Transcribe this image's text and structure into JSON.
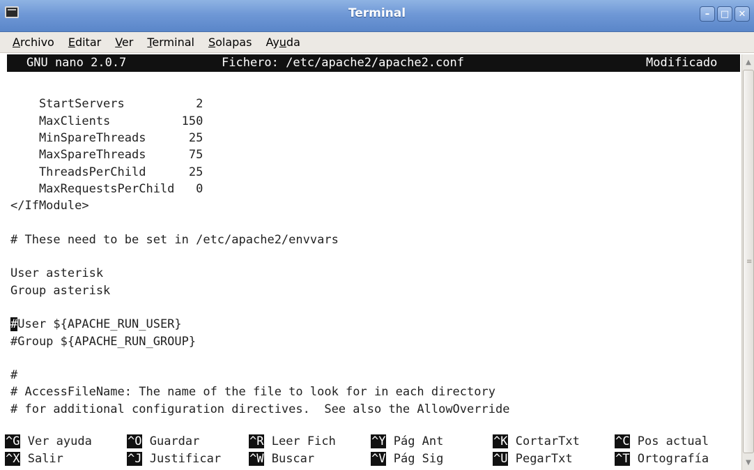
{
  "window": {
    "title": "Terminal",
    "buttons": [
      "minimize-icon",
      "maximize-icon",
      "close-icon"
    ]
  },
  "menubar": {
    "items": [
      {
        "label": "Archivo",
        "mnemonic": "A"
      },
      {
        "label": "Editar",
        "mnemonic": "E"
      },
      {
        "label": "Ver",
        "mnemonic": "V"
      },
      {
        "label": "Terminal",
        "mnemonic": "T"
      },
      {
        "label": "Solapas",
        "mnemonic": "S"
      },
      {
        "label": "Ayuda",
        "mnemonic": "u"
      }
    ]
  },
  "nano": {
    "version": "GNU nano 2.0.7",
    "file": "Fichero: /etc/apache2/apache2.conf",
    "status": "Modificado"
  },
  "content": {
    "lines": [
      "",
      "    StartServers          2",
      "    MaxClients          150",
      "    MinSpareThreads      25",
      "    MaxSpareThreads      75",
      "    ThreadsPerChild      25",
      "    MaxRequestsPerChild   0",
      "</IfModule>",
      "",
      "# These need to be set in /etc/apache2/envvars",
      "",
      "User asterisk",
      "Group asterisk",
      "",
      "#User ${APACHE_RUN_USER}",
      "#Group ${APACHE_RUN_GROUP}",
      "",
      "#",
      "# AccessFileName: The name of the file to look for in each directory",
      "# for additional configuration directives.  See also the AllowOverride"
    ],
    "cursor_line": 14,
    "cursor_char": "#",
    "cursor_rest": "User ${APACHE_RUN_USER}"
  },
  "shortcuts": [
    {
      "key": "^G",
      "label": "Ver ayuda"
    },
    {
      "key": "^O",
      "label": "Guardar"
    },
    {
      "key": "^R",
      "label": "Leer Fich"
    },
    {
      "key": "^Y",
      "label": "Pág Ant"
    },
    {
      "key": "^K",
      "label": "CortarTxt"
    },
    {
      "key": "^C",
      "label": "Pos actual"
    },
    {
      "key": "^X",
      "label": "Salir"
    },
    {
      "key": "^J",
      "label": "Justificar"
    },
    {
      "key": "^W",
      "label": "Buscar"
    },
    {
      "key": "^V",
      "label": "Pág Sig"
    },
    {
      "key": "^U",
      "label": "PegarTxt"
    },
    {
      "key": "^T",
      "label": "Ortografía"
    }
  ],
  "colors": {
    "titlebar": "#6f98d6",
    "terminal_bg": "#ffffff",
    "terminal_fg": "#222222",
    "nano_bar": "#111111"
  }
}
